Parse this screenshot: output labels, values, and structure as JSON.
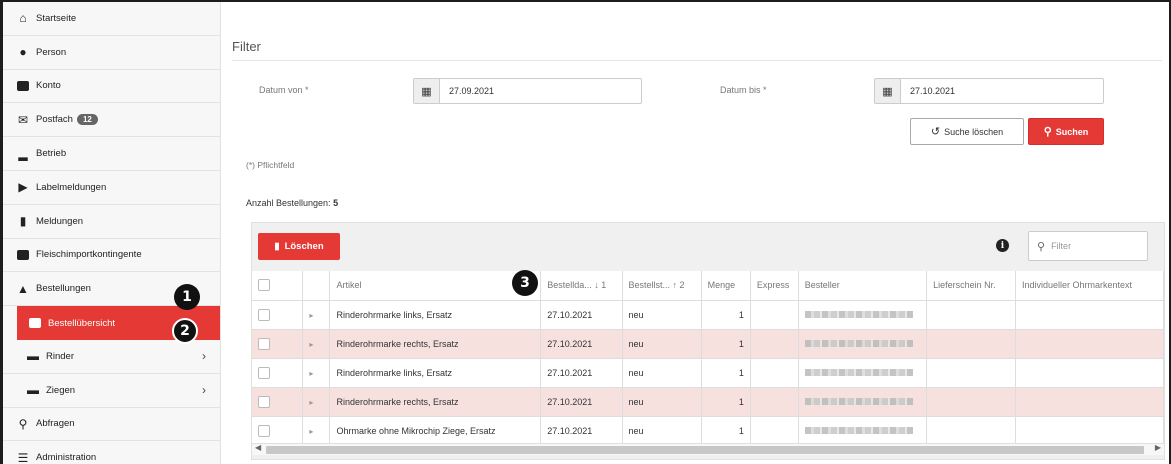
{
  "sidebar": {
    "items": [
      {
        "label": "Startseite",
        "icon": "home-icon"
      },
      {
        "label": "Person",
        "icon": "person-icon"
      },
      {
        "label": "Konto",
        "icon": "id-card-icon"
      },
      {
        "label": "Postfach",
        "icon": "envelope-icon",
        "badge": "12"
      },
      {
        "label": "Betrieb",
        "icon": "factory-icon"
      },
      {
        "label": "Labelmeldungen",
        "icon": "tag-icon"
      },
      {
        "label": "Meldungen",
        "icon": "clipboard-icon"
      },
      {
        "label": "Fleischimportkontingente",
        "icon": "calendar-icon"
      },
      {
        "label": "Bestellungen",
        "icon": "shopping-bag-icon"
      },
      {
        "label": "Bestellübersicht",
        "icon": "list-icon",
        "active": true
      },
      {
        "label": "Rinder",
        "icon": "cow-icon"
      },
      {
        "label": "Ziegen",
        "icon": "goat-icon"
      },
      {
        "label": "Abfragen",
        "icon": "search-icon"
      },
      {
        "label": "Administration",
        "icon": "admin-icon"
      }
    ]
  },
  "callouts": {
    "one": "1",
    "two": "2",
    "three": "3"
  },
  "filter": {
    "title": "Filter",
    "date_from_label": "Datum von *",
    "date_from_value": "27.09.2021",
    "date_to_label": "Datum bis *",
    "date_to_value": "27.10.2021",
    "clear_label": "Suche löschen",
    "search_label": "Suchen",
    "required_note": "(*) Pflichtfeld"
  },
  "orders": {
    "count_label": "Anzahl Bestellungen:",
    "count_value": "5",
    "delete_label": "Löschen",
    "filter_placeholder": "Filter",
    "columns": [
      "",
      "",
      "Artikel",
      "Bestellda... ↓ 1",
      "Bestellst... ↑ 2",
      "Menge",
      "Express",
      "Besteller",
      "Lieferschein Nr.",
      "Individueller Ohrmarkentext"
    ],
    "rows": [
      {
        "artikel": "Rinderohrmarke links, Ersatz",
        "datum": "27.10.2021",
        "status": "neu",
        "menge": "1",
        "pink": false
      },
      {
        "artikel": "Rinderohrmarke rechts, Ersatz",
        "datum": "27.10.2021",
        "status": "neu",
        "menge": "1",
        "pink": true
      },
      {
        "artikel": "Rinderohrmarke links, Ersatz",
        "datum": "27.10.2021",
        "status": "neu",
        "menge": "1",
        "pink": false
      },
      {
        "artikel": "Rinderohrmarke rechts, Ersatz",
        "datum": "27.10.2021",
        "status": "neu",
        "menge": "1",
        "pink": true
      },
      {
        "artikel": "Ohrmarke ohne Mikrochip Ziege, Ersatz",
        "datum": "27.10.2021",
        "status": "neu",
        "menge": "1",
        "pink": false
      }
    ]
  },
  "colors": {
    "accent": "#e53935",
    "row_highlight": "#f6e1df"
  }
}
